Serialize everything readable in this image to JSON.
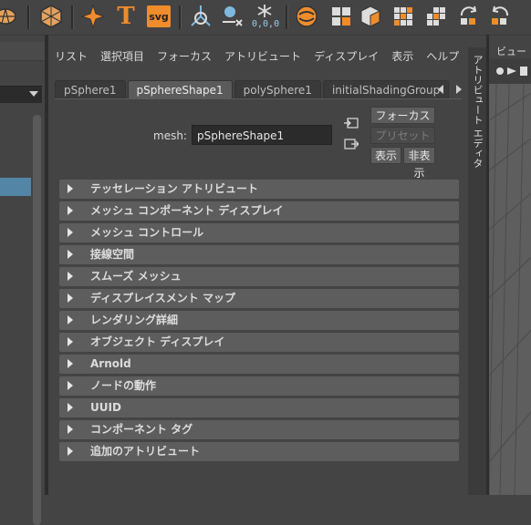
{
  "shelf": {
    "icons": [
      "polygon-sphere-icon",
      "polyhedron-icon",
      "star-icon",
      "text-tool-icon",
      "svg-tool-icon",
      "sweep-mesh-icon",
      "type-tool-icon",
      "snowflake-icon",
      "circularize-icon",
      "checker-plane-icon",
      "cube-extract-icon",
      "grid-icon",
      "partial-grid-icon",
      "rotate-grid-icon",
      "rotate-grid-alt-icon"
    ],
    "text_tool_label": "T",
    "svg_label": "svg",
    "coord_label": "0,0,0",
    "accent": "#f08c2c"
  },
  "left_panel": {
    "selected_color": "#5285a6"
  },
  "menu": [
    "リスト",
    "選択項目",
    "フォーカス",
    "アトリビュート",
    "ディスプレイ",
    "表示",
    "ヘルプ"
  ],
  "tabs": [
    "pSphere1",
    "pSphereShape1",
    "polySphere1",
    "initialShadingGroup"
  ],
  "active_tab": "pSphereShape1",
  "mesh": {
    "label": "mesh:",
    "value": "pSphereShape1"
  },
  "buttons": {
    "focus": "フォーカス",
    "presets": "プリセット",
    "show": "表示",
    "hide": "非表示"
  },
  "sections": [
    "テッセレーション アトリビュート",
    "メッシュ コンポーネント ディスプレイ",
    "メッシュ コントロール",
    "接線空間",
    "スムーズ メッシュ",
    "ディスプレイスメント マップ",
    "レンダリング詳細",
    "オブジェクト ディスプレイ",
    "Arnold",
    "ノードの動作",
    "UUID",
    "コンポーネント タグ",
    "追加のアトリビュート"
  ],
  "side_tab": "アトリビュート エディタ",
  "viewport": {
    "menu": "ビュー"
  }
}
